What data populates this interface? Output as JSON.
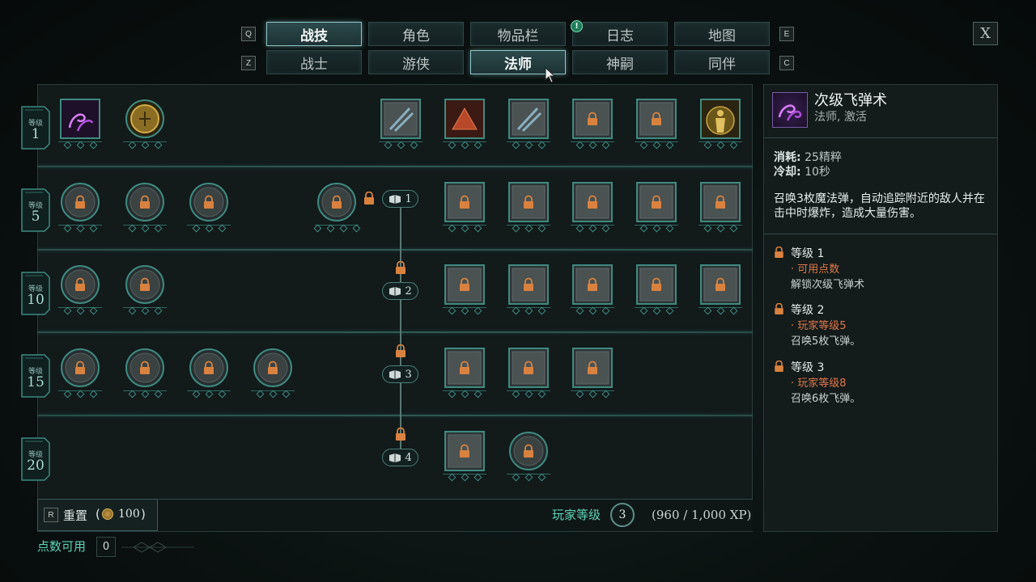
{
  "nav": {
    "top_tabs": [
      {
        "label": "战技",
        "active": true
      },
      {
        "label": "角色",
        "active": false
      },
      {
        "label": "物品栏",
        "active": false
      },
      {
        "label": "日志",
        "active": false
      },
      {
        "label": "地图",
        "active": false
      }
    ],
    "class_tabs": [
      {
        "label": "战士",
        "active": false
      },
      {
        "label": "游侠",
        "active": false
      },
      {
        "label": "法师",
        "active": true
      },
      {
        "label": "神嗣",
        "active": false
      },
      {
        "label": "同伴",
        "active": false
      }
    ],
    "keys": {
      "prev_top": "Q",
      "next_top": "E",
      "prev_class": "Z",
      "next_class": "C"
    },
    "alert_mark": "!",
    "close_label": "X"
  },
  "levels": [
    {
      "label": "等级",
      "value": "1"
    },
    {
      "label": "等级",
      "value": "5"
    },
    {
      "label": "等级",
      "value": "10"
    },
    {
      "label": "等级",
      "value": "15"
    },
    {
      "label": "等级",
      "value": "20"
    }
  ],
  "ranks": [
    "1",
    "2",
    "3",
    "4"
  ],
  "bottom": {
    "reset_key": "R",
    "reset_label": "重置",
    "reset_cost_open": "(",
    "reset_cost": "100",
    "reset_cost_close": ")",
    "player_level_label": "玩家等级",
    "player_level": "3",
    "xp": "(960 / 1,000 XP)",
    "points_label": "点数可用",
    "points": "0"
  },
  "detail": {
    "title": "次级飞弹术",
    "subtitle": "法师, 激活",
    "cost_label": "消耗:",
    "cost_value": "25精粹",
    "cooldown_label": "冷却:",
    "cooldown_value": "10秒",
    "description": "召唤3枚魔法弹，自动追踪附近的敌人并在击中时爆炸，造成大量伤害。",
    "ranks": [
      {
        "title": "等级 1",
        "req": "· 可用点数",
        "effect": "解锁次级飞弹术"
      },
      {
        "title": "等级 2",
        "req": "· 玩家等级5",
        "effect": "召唤5枚飞弹。"
      },
      {
        "title": "等级 3",
        "req": "· 玩家等级8",
        "effect": "召唤6枚飞弹。"
      }
    ]
  },
  "colors": {
    "accent": "#5fd3b7",
    "requirement": "#e0784a",
    "lock": "#d9823f",
    "magic": "#b04fd8"
  }
}
